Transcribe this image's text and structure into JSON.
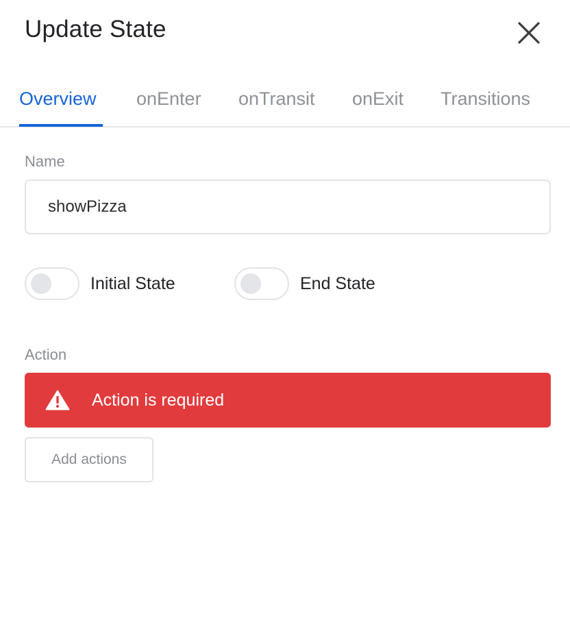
{
  "dialog": {
    "title": "Update State",
    "close_icon": "close-icon"
  },
  "tabs": [
    {
      "label": "Overview",
      "active": true
    },
    {
      "label": "onEnter",
      "active": false
    },
    {
      "label": "onTransit",
      "active": false
    },
    {
      "label": "onExit",
      "active": false
    },
    {
      "label": "Transitions",
      "active": false
    }
  ],
  "name_field": {
    "label": "Name",
    "value": "showPizza"
  },
  "toggles": {
    "initial_state": {
      "label": "Initial State",
      "on": false
    },
    "end_state": {
      "label": "End State",
      "on": false
    }
  },
  "action": {
    "label": "Action",
    "error": {
      "icon": "warning-icon",
      "message": "Action is required"
    },
    "add_button_label": "Add actions"
  },
  "colors": {
    "accent": "#1565d8",
    "error": "#e23b3d",
    "muted_text": "#8a8d93",
    "border": "#e1e3e7"
  }
}
